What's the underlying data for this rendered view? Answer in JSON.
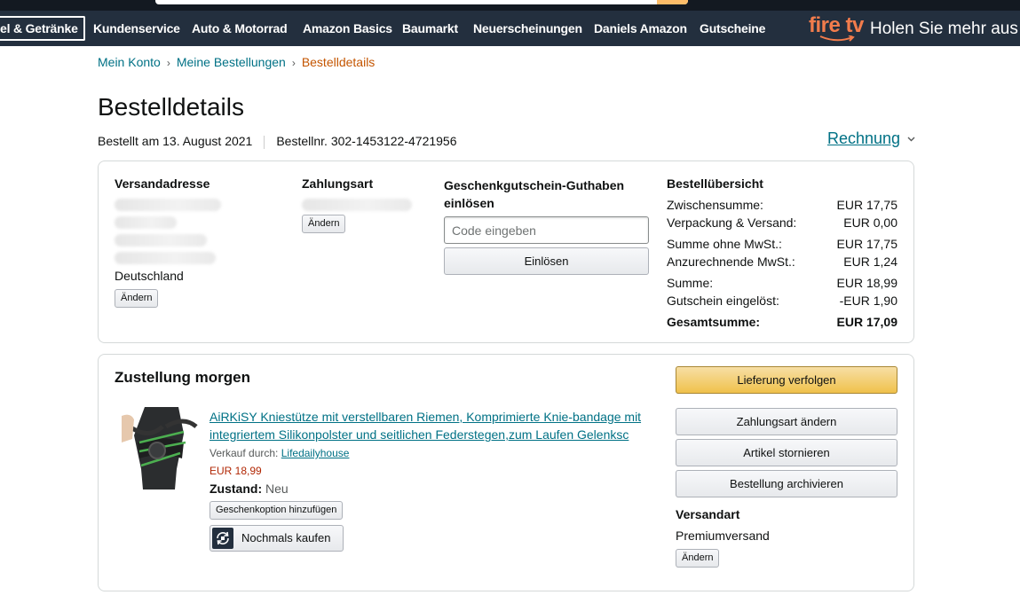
{
  "nav": {
    "items": [
      "el & Getränke",
      "Kundenservice",
      "Auto & Motorrad",
      "Amazon Basics",
      "Baumarkt",
      "Neuerscheinungen",
      "Daniels Amazon",
      "Gutscheine"
    ],
    "promo_brand": "fire tv",
    "promo_text": "Holen Sie mehr aus"
  },
  "breadcrumb": {
    "items": [
      "Mein Konto",
      "Meine Bestellungen"
    ],
    "current": "Bestelldetails",
    "separator": "›"
  },
  "page": {
    "title": "Bestelldetails",
    "ordered_on": "Bestellt am 13. August 2021",
    "order_number": "Bestellnr. 302-1453122-4721956",
    "invoice_label": "Rechnung"
  },
  "shipping": {
    "heading": "Versandadresse",
    "country": "Deutschland",
    "change_label": "Ändern"
  },
  "payment": {
    "heading": "Zahlungsart",
    "change_label": "Ändern"
  },
  "giftcard": {
    "heading": "Geschenkgutschein-Guthaben einlösen",
    "placeholder": "Code eingeben",
    "redeem_label": "Einlösen"
  },
  "summary": {
    "heading": "Bestellübersicht",
    "rows": [
      {
        "label": "Zwischensumme:",
        "value": "EUR 17,75"
      },
      {
        "label": "Verpackung & Versand:",
        "value": "EUR 0,00"
      },
      {
        "label": "Summe ohne MwSt.:",
        "value": "EUR 17,75"
      },
      {
        "label": "Anzurechnende MwSt.:",
        "value": "EUR 1,24"
      },
      {
        "label": "Summe:",
        "value": "EUR 18,99"
      },
      {
        "label": "Gutschein eingelöst:",
        "value": "-EUR 1,90"
      }
    ],
    "total_label": "Gesamtsumme:",
    "total_value": "EUR 17,09"
  },
  "delivery": {
    "heading": "Zustellung morgen",
    "product_title": "AiRKiSY Kniestütze mit verstellbaren Riemen, Komprimierte Knie-bandage mit integriertem Silikonpolster und seitlichen Federstegen,zum Laufen Gelenksc",
    "seller_prefix": "Verkauf durch:",
    "seller_name": "Lifedailyhouse",
    "price": "EUR 18,99",
    "condition_label": "Zustand:",
    "condition_value": "Neu",
    "gift_option_label": "Geschenkoption hinzufügen",
    "buy_again_label": "Nochmals kaufen",
    "track_label": "Lieferung verfolgen",
    "change_payment_label": "Zahlungsart ändern",
    "cancel_label": "Artikel stornieren",
    "archive_label": "Bestellung archivieren",
    "shipping_method_heading": "Versandart",
    "shipping_method_value": "Premiumversand",
    "shipping_method_change": "Ändern"
  },
  "colors": {
    "nav_bg": "#232f3e",
    "link": "#007185",
    "price": "#b12704",
    "breadcrumb_current": "#c45500",
    "primary_button": "#f0c14b",
    "firetv_orange": "#f27c4c"
  }
}
